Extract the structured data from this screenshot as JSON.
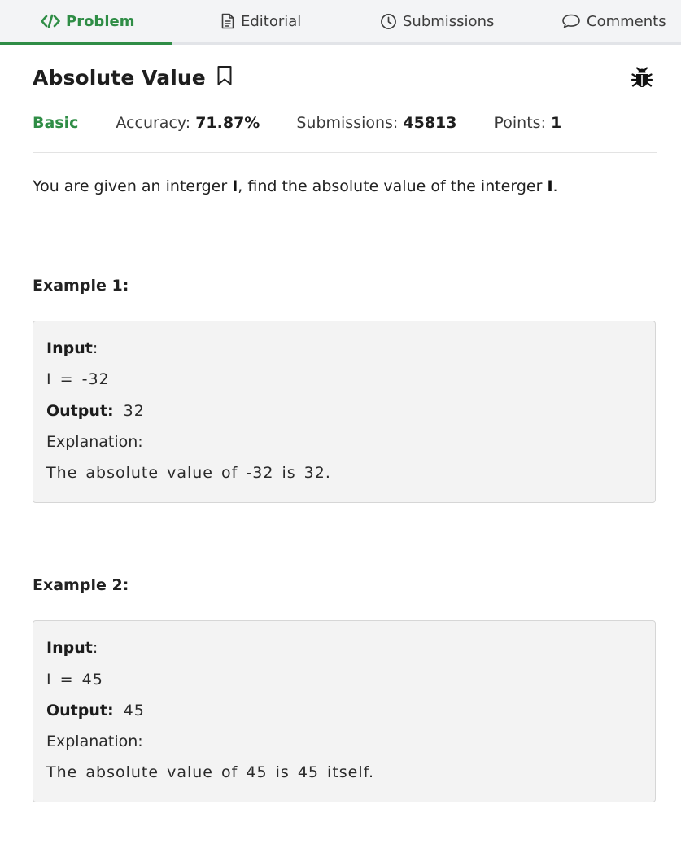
{
  "tabs": [
    {
      "label": "Problem",
      "icon": "code-icon",
      "active": true
    },
    {
      "label": "Editorial",
      "icon": "document-icon",
      "active": false
    },
    {
      "label": "Submissions",
      "icon": "clock-icon",
      "active": false
    },
    {
      "label": "Comments",
      "icon": "comment-bubble-icon",
      "active": false
    }
  ],
  "problem": {
    "title": "Absolute Value",
    "difficulty": "Basic",
    "accuracy_label": "Accuracy: ",
    "accuracy_value": "71.87%",
    "submissions_label": "Submissions: ",
    "submissions_value": "45813",
    "points_label": "Points: ",
    "points_value": "1"
  },
  "statement": {
    "part1": "You are given an interger ",
    "var1": "I",
    "part2": ", find the absolute value of the interger ",
    "var2": "I",
    "part3": "."
  },
  "examples": [
    {
      "title": "Example 1:",
      "input_label": "Input",
      "input_colon": ":",
      "input_value": "I = -32",
      "output_label": "Output:",
      "output_value": "32",
      "explanation_label": "Explanation:",
      "explanation_text": "The absolute value of -32 is 32."
    },
    {
      "title": "Example 2:",
      "input_label": "Input",
      "input_colon": ":",
      "input_value": "I = 45",
      "output_label": "Output:",
      "output_value": "45",
      "explanation_label": "Explanation:",
      "explanation_text": "The absolute value of 45 is 45 itself."
    }
  ],
  "colors": {
    "accent": "#2f8d46",
    "tab_bar_bg": "#f3f4f6",
    "example_bg": "#f3f3f3"
  }
}
